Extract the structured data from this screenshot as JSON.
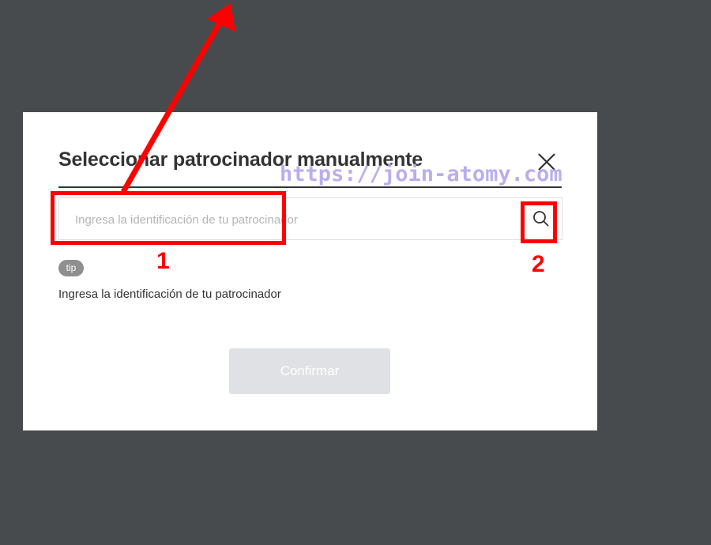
{
  "modal": {
    "title": "Seleccionar patrocinador manualmente",
    "search_placeholder": "Ingresa la identificación de tu patrocinador",
    "tip_label": "tip",
    "tip_text": "Ingresa la identificación de tu patrocinador",
    "confirm_label": "Confirmar"
  },
  "watermark": "https://join-atomy.com",
  "annotations": {
    "label_1": "1",
    "label_2": "2",
    "color": "#ff0000"
  },
  "icons": {
    "close": "close-icon",
    "search": "search-icon"
  },
  "colors": {
    "overlay": "#474b4e",
    "modal_bg": "#ffffff",
    "confirm_disabled": "#dfe1e4",
    "tip_badge": "#8f8f8f",
    "watermark": "#b3a6ee"
  }
}
